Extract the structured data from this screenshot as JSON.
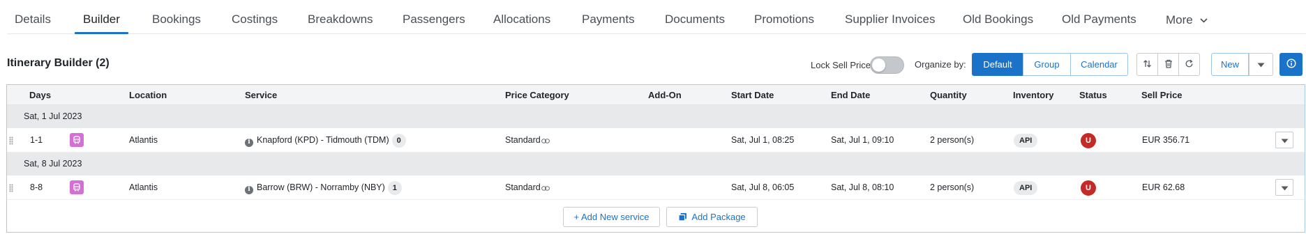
{
  "tabs": [
    {
      "label": "Details"
    },
    {
      "label": "Builder",
      "active": true
    },
    {
      "label": "Bookings"
    },
    {
      "label": "Costings"
    },
    {
      "label": "Breakdowns"
    },
    {
      "label": "Passengers"
    },
    {
      "label": "Allocations"
    },
    {
      "label": "Payments"
    },
    {
      "label": "Documents"
    },
    {
      "label": "Promotions"
    },
    {
      "label": "Supplier Invoices"
    },
    {
      "label": "Old Bookings"
    },
    {
      "label": "Old Payments"
    },
    {
      "label": "More",
      "icon": "chevron-down-icon"
    }
  ],
  "header": {
    "title": "Itinerary Builder (2)",
    "lock_sell_price_label": "Lock Sell Price",
    "lock_sell_price_on": false,
    "organize_label": "Organize by:",
    "organize_options": [
      "Default",
      "Group",
      "Calendar"
    ],
    "organize_selected": "Default",
    "icon_buttons": [
      "sort-icon",
      "trash-icon",
      "refresh-icon"
    ],
    "new_label": "New",
    "info_icon": "info-icon"
  },
  "table": {
    "columns": [
      "Days",
      "Location",
      "Service",
      "Price Category",
      "Add-On",
      "Start Date",
      "End Date",
      "Quantity",
      "Inventory",
      "Status",
      "Sell Price"
    ],
    "groups": [
      {
        "date": "Sat, 1 Jul 2023",
        "rows": [
          {
            "days": "1-1",
            "type_icon": "train-icon",
            "location": "Atlantis",
            "service": "Knapford (KPD) - Tidmouth (TDM)",
            "service_count": "0",
            "price_category": "Standard",
            "add_on": "",
            "start_date": "Sat, Jul 1, 08:25",
            "end_date": "Sat, Jul 1, 09:10",
            "quantity": "2 person(s)",
            "inventory": "API",
            "status": "U",
            "sell_price": "EUR 356.71"
          }
        ]
      },
      {
        "date": "Sat, 8 Jul 2023",
        "rows": [
          {
            "days": "8-8",
            "type_icon": "train-icon",
            "location": "Atlantis",
            "service": "Barrow (BRW) - Norramby (NBY)",
            "service_count": "1",
            "price_category": "Standard",
            "add_on": "",
            "start_date": "Sat, Jul 8, 06:05",
            "end_date": "Sat, Jul 8, 08:10",
            "quantity": "2 person(s)",
            "inventory": "API",
            "status": "U",
            "sell_price": "EUR 62.68"
          }
        ]
      }
    ],
    "add_service_label": "+ Add New service",
    "add_package_label": "Add Package"
  },
  "colors": {
    "accent": "#1a73c9",
    "status_unconfirmed": "#c42b27",
    "service_type": "#d46fd6"
  }
}
